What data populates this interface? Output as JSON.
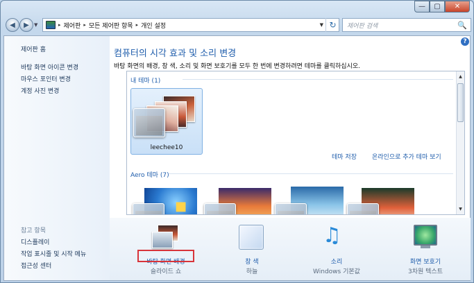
{
  "window": {
    "minimize": "—",
    "maximize": "▢",
    "close": "✕"
  },
  "nav": {
    "back": "◀",
    "forward": "▶",
    "history": "▼",
    "refresh": "↻"
  },
  "address": {
    "crumbs": [
      "제어판",
      "모든 제어판 항목",
      "개인 설정"
    ],
    "sep": "▸"
  },
  "search": {
    "placeholder": "제어판 검색",
    "icon": "🔍"
  },
  "sidebar": {
    "home": "제어판 홈",
    "links": [
      "바탕 화면 아이콘 변경",
      "마우스 포인터 변경",
      "계정 사진 변경"
    ],
    "see_also_heading": "참고 항목",
    "see_also": [
      "디스플레이",
      "작업 표시줄 및 시작 메뉴",
      "접근성 센터"
    ]
  },
  "main": {
    "help": "?",
    "title": "컴퓨터의 시각 효과 및 소리 변경",
    "description": "바탕 화면의 배경, 창 색, 소리 및 화면 보호기를 모두 한 번에 변경하려면 테마를 클릭하십시오.",
    "my_themes_label": "내 테마 (1)",
    "my_theme_name": "leechee10",
    "save_theme": "테마 저장",
    "get_more_online": "온라인으로 추가 테마 보기",
    "aero_label": "Aero 테마 (7)",
    "scroll_up": "▲",
    "scroll_down": "▼"
  },
  "bottom": {
    "items": [
      {
        "title": "바탕 화면 배경",
        "sub": "슬라이드 쇼"
      },
      {
        "title": "창 색",
        "sub": "하늘"
      },
      {
        "title": "소리",
        "sub": "Windows 기본값"
      },
      {
        "title": "화면 보호기",
        "sub": "3차원 텍스트"
      }
    ],
    "sound_glyph": "♫"
  },
  "colors": {
    "accent": "#1e5cab",
    "highlight": "#d8343a"
  }
}
